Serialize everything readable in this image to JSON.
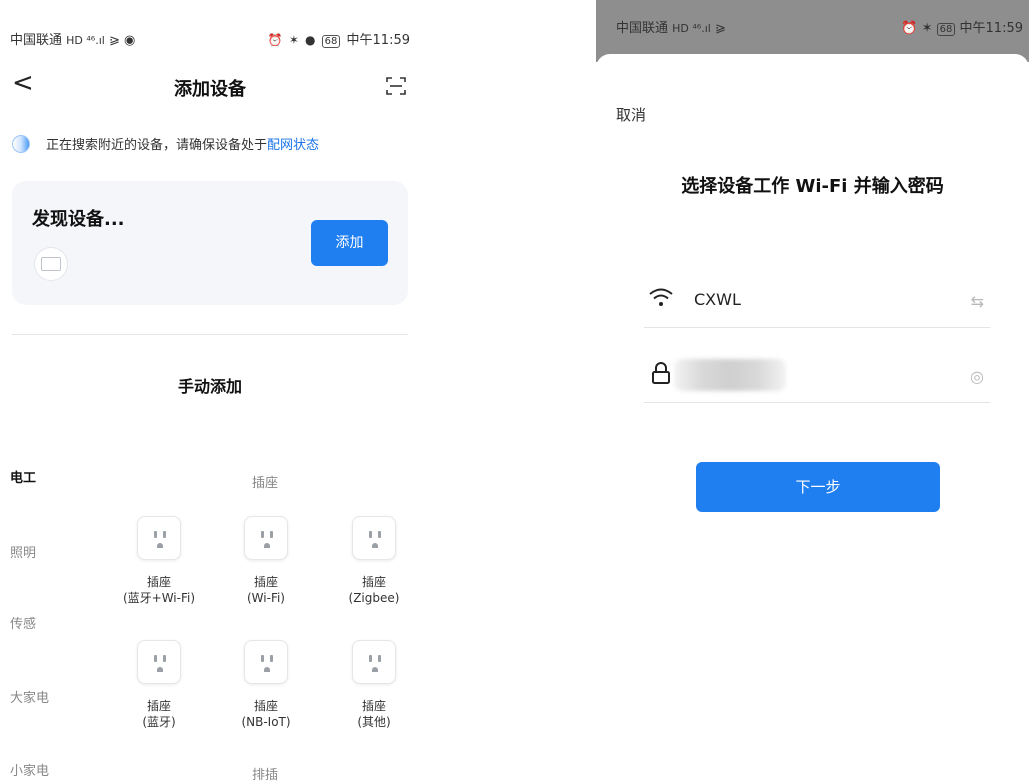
{
  "left": {
    "status_bar": {
      "carrier": "中国联通",
      "net": "HD ⁴⁶.ıl",
      "time": "中午11:59",
      "battery": "68"
    },
    "nav": {
      "back": "<",
      "title": "添加设备"
    },
    "tip": {
      "text": "正在搜索附近的设备，请确保设备处于",
      "link": "配网状态"
    },
    "found": {
      "title": "发现设备...",
      "add_button": "添加"
    },
    "manual_title": "手动添加",
    "categories": [
      "电工",
      "照明",
      "传感",
      "大家电",
      "小家电"
    ],
    "section_sockets": "插座",
    "section_strips": "排插",
    "devices": [
      {
        "line1": "插座",
        "line2": "(蓝牙+Wi-Fi)"
      },
      {
        "line1": "插座",
        "line2": "(Wi-Fi)"
      },
      {
        "line1": "插座",
        "line2": "(Zigbee)"
      },
      {
        "line1": "插座",
        "line2": "(蓝牙)"
      },
      {
        "line1": "插座",
        "line2": "(NB-IoT)"
      },
      {
        "line1": "插座",
        "line2": "(其他)"
      }
    ]
  },
  "right": {
    "status_bar": {
      "carrier": "中国联通",
      "net": "HD ⁴⁶.ıl",
      "time": "中午11:59",
      "battery": "68"
    },
    "cancel": "取消",
    "title": "选择设备工作 Wi-Fi 并输入密码",
    "wifi_name": "CXWL",
    "next_button": "下一步"
  },
  "colors": {
    "accent": "#1f7ef0",
    "link": "#1a73e8"
  }
}
